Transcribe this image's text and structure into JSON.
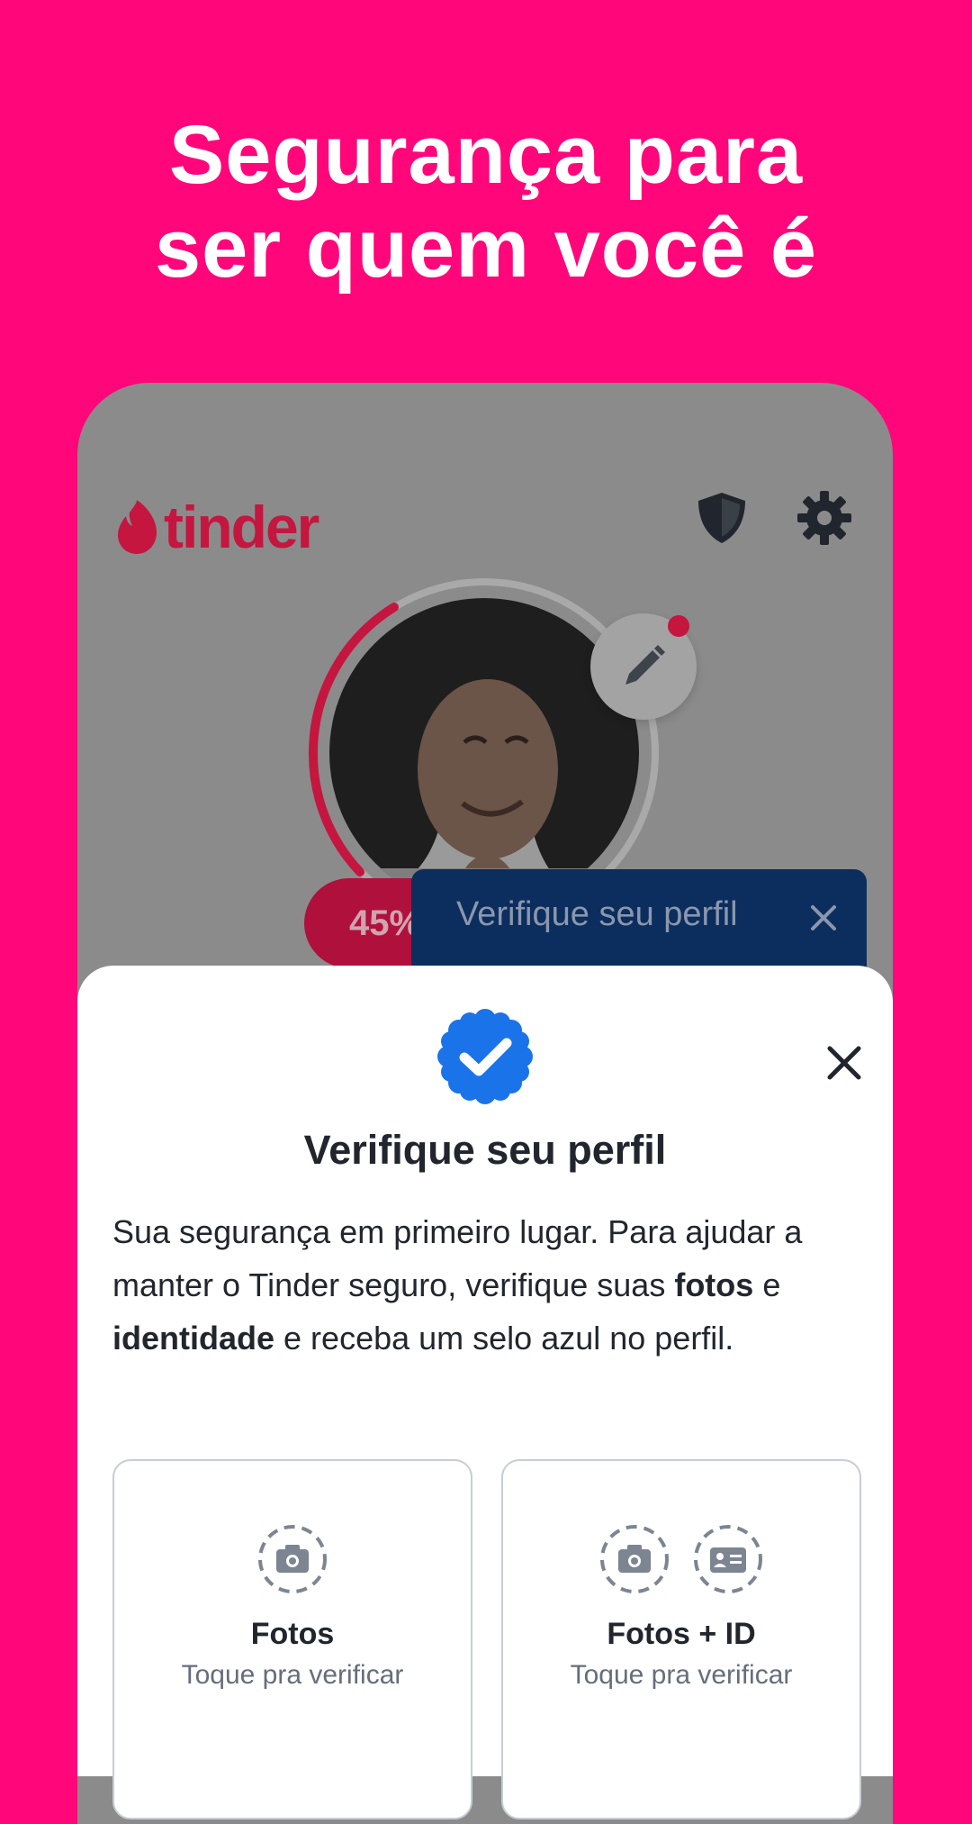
{
  "headline": {
    "line1": "Segurança para",
    "line2": "ser quem você é"
  },
  "app": {
    "logo_text": "tinder",
    "brand_color": "#C4163F",
    "header_icons": [
      "shield-icon",
      "gear-icon"
    ],
    "profile_progress": "45%",
    "profile_progress_value": 0.45
  },
  "tooltip": {
    "text": "Verifique seu perfil"
  },
  "sheet": {
    "title": "Verifique seu perfil",
    "body": {
      "part1": "Sua segurança em primeiro lugar. Para ajudar a manter o Tinder seguro, verifique suas ",
      "bold1": "fotos",
      "part2": " e ",
      "bold2": "identidade",
      "part3": " e receba um selo azul no perfil."
    },
    "options": [
      {
        "title": "Fotos",
        "subtitle": "Toque pra verificar",
        "icons": [
          "camera-icon"
        ]
      },
      {
        "title": "Fotos + ID",
        "subtitle": "Toque pra verificar",
        "icons": [
          "camera-icon",
          "id-card-icon"
        ]
      }
    ]
  },
  "colors": {
    "background": "#FF067A",
    "verified_blue": "#1A73E8",
    "tooltip_bg": "#0C2E5E"
  }
}
